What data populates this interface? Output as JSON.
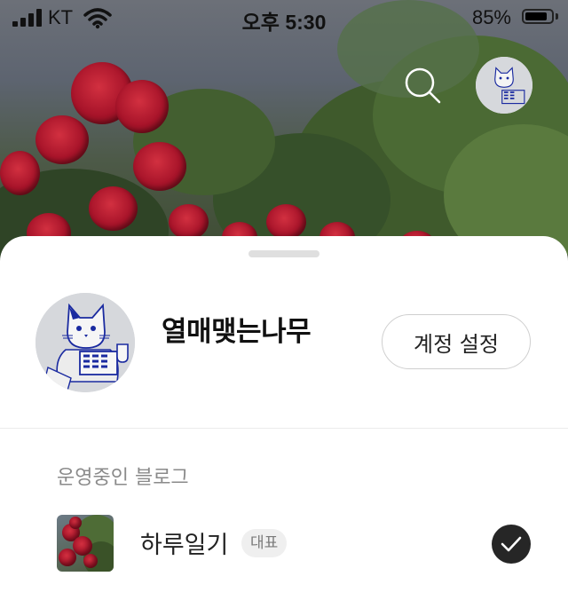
{
  "status_bar": {
    "carrier": "KT",
    "time": "오후 5:30",
    "battery_percent": "85%",
    "battery_level": 0.85
  },
  "header": {
    "search_icon": "search-icon",
    "avatar_icon": "cat-illustration-avatar"
  },
  "profile": {
    "name": "열매맺는나무",
    "account_settings_label": "계정 설정"
  },
  "blogs_section": {
    "title": "운영중인 블로그",
    "items": [
      {
        "name": "하루일기",
        "badge": "대표",
        "selected": true
      }
    ]
  },
  "colors": {
    "sheet_bg": "#ffffff",
    "check_bg": "#262626",
    "badge_bg": "#efefef",
    "muted_text": "#8a8a8a"
  }
}
